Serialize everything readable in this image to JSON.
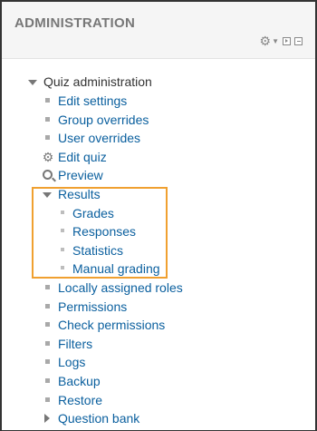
{
  "block": {
    "title": "ADMINISTRATION"
  },
  "tree": {
    "root": "Quiz administration",
    "items": [
      {
        "label": "Edit settings",
        "icon": "bullet"
      },
      {
        "label": "Group overrides",
        "icon": "bullet"
      },
      {
        "label": "User overrides",
        "icon": "bullet"
      },
      {
        "label": "Edit quiz",
        "icon": "gear-icon"
      },
      {
        "label": "Preview",
        "icon": "search-icon"
      },
      {
        "label": "Results",
        "icon": "expanded-triangle",
        "children": [
          {
            "label": "Grades"
          },
          {
            "label": "Responses"
          },
          {
            "label": "Statistics"
          },
          {
            "label": "Manual grading"
          }
        ]
      },
      {
        "label": "Locally assigned roles",
        "icon": "bullet"
      },
      {
        "label": "Permissions",
        "icon": "bullet"
      },
      {
        "label": "Check permissions",
        "icon": "bullet"
      },
      {
        "label": "Filters",
        "icon": "bullet"
      },
      {
        "label": "Logs",
        "icon": "bullet"
      },
      {
        "label": "Backup",
        "icon": "bullet"
      },
      {
        "label": "Restore",
        "icon": "bullet"
      },
      {
        "label": "Question bank",
        "icon": "collapsed-triangle"
      }
    ]
  },
  "colors": {
    "link": "#0a5f9e",
    "highlight_border": "#f0a030"
  }
}
